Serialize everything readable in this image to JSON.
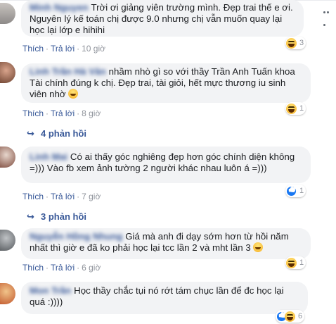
{
  "common": {
    "like": "Thích",
    "reply": "Trả lời",
    "sep": "·"
  },
  "comments": [
    {
      "name": "Minh Nguyen",
      "text": "Trời ơi giảng viên trường mình. Đẹp trai thế e ơi. Nguyên lý kế toán chị được 9.0 nhưng chị vẫn muốn quay lại học lại lớp e hihihi",
      "time": "10 giờ",
      "reaction_count": "3"
    },
    {
      "name": "Linh Trần Hà Vân",
      "text": "nhầm nhò gì so với thầy Trần Anh Tuấn khoa Tài chính đúng k chị. Đẹp trai, tài giỏi, hết mực thương iu sinh viên nhờ",
      "time": "8 giờ",
      "reaction_count": "1",
      "replies": "4 phản hồi"
    },
    {
      "name": "Linh Mai",
      "text": "Có ai thấy góc nghiêng đẹp hơn góc chính diện không =))) Vào fb xem ảnh tường 2 người khác nhau luôn á =)))",
      "time": "7 giờ",
      "reaction_count": "1",
      "replies": "3 phản hồi"
    },
    {
      "name": "Nguyễn Hồng Nhung",
      "text": "Giá mà anh đi dạy sớm hơn từ hồi năm nhất thì giờ e đã ko phải học lại tcc lần 2 và mht lần 3",
      "time": "6 giờ",
      "reaction_count": "1"
    },
    {
      "name": "Mon Trần",
      "text": "Học thầy chắc tụi nó rớt tám chục lần để đc học lại quá :))))",
      "time": "4 giờ",
      "reaction_count": "6"
    }
  ]
}
